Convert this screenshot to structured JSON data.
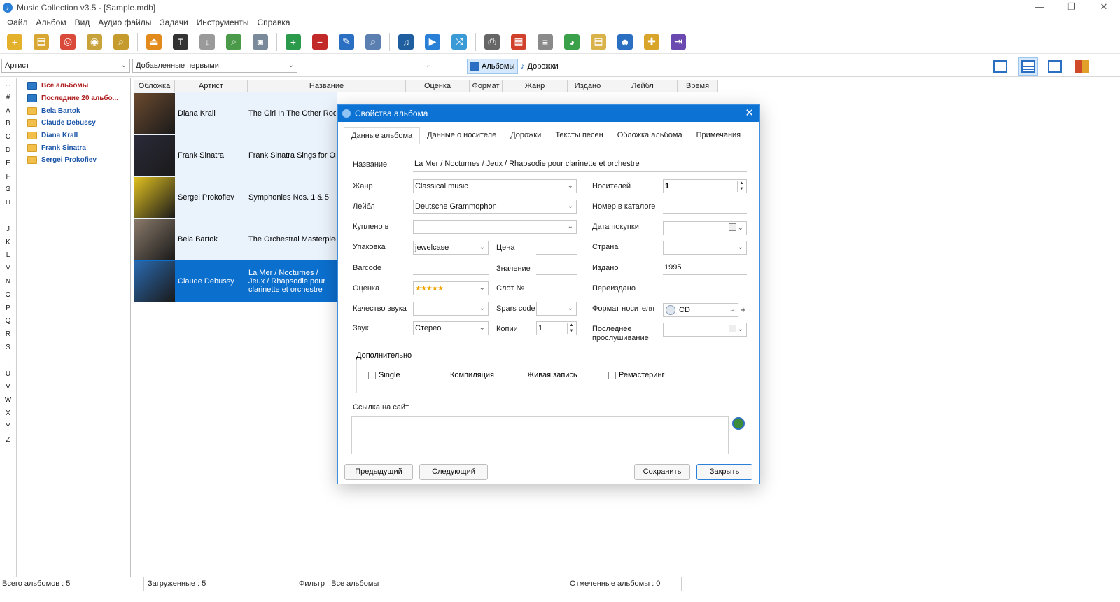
{
  "window": {
    "title": "Music Collection v3.5 - [Sample.mdb]",
    "controls": [
      "—",
      "❐",
      "✕"
    ]
  },
  "menu": [
    "Файл",
    "Альбом",
    "Вид",
    "Аудио файлы",
    "Задачи",
    "Инструменты",
    "Справка"
  ],
  "toolbar": {
    "buttons": [
      {
        "name": "add-album-icon",
        "color": "#e3b12b",
        "glyph": "+"
      },
      {
        "name": "add-folder-icon",
        "color": "#d8a632",
        "glyph": "▤"
      },
      {
        "name": "lifebuoy-icon",
        "color": "#d94a3a",
        "glyph": "◎"
      },
      {
        "name": "disc-add-icon",
        "color": "#c8a23a",
        "glyph": "◉"
      },
      {
        "name": "search-file-icon",
        "color": "#c59b2e",
        "glyph": "⌕"
      },
      {
        "name": "eject-icon",
        "color": "#e38a1c",
        "glyph": "⏏"
      },
      {
        "name": "text-disc-icon",
        "color": "#333333",
        "glyph": "T"
      },
      {
        "name": "download-icon",
        "color": "#9a9a9a",
        "glyph": "↓"
      },
      {
        "name": "find-icon",
        "color": "#4a9a4a",
        "glyph": "⌕"
      },
      {
        "name": "camera-icon",
        "color": "#7a8a9a",
        "glyph": "◙"
      },
      {
        "name": "new-record-icon",
        "color": "#2b9a4a",
        "glyph": "+"
      },
      {
        "name": "delete-icon",
        "color": "#c22a2a",
        "glyph": "−"
      },
      {
        "name": "edit-icon",
        "color": "#2a6fc2",
        "glyph": "✎"
      },
      {
        "name": "search-list-icon",
        "color": "#5a7fb0",
        "glyph": "⌕"
      },
      {
        "name": "search-music-icon",
        "color": "#1f5f9f",
        "glyph": "♫"
      },
      {
        "name": "play-icon",
        "color": "#2a7fd6",
        "glyph": "▶"
      },
      {
        "name": "shuffle-icon",
        "color": "#3a9ad6",
        "glyph": "⤨"
      },
      {
        "name": "print-icon",
        "color": "#666666",
        "glyph": "⎙"
      },
      {
        "name": "calendar-icon",
        "color": "#d0402a",
        "glyph": "▦"
      },
      {
        "name": "report-icon",
        "color": "#8a8a8a",
        "glyph": "≡"
      },
      {
        "name": "pie-chart-icon",
        "color": "#3aa04a",
        "glyph": "◕"
      },
      {
        "name": "notes-icon",
        "color": "#d9b24a",
        "glyph": "▤"
      },
      {
        "name": "user-icon",
        "color": "#2a6fc2",
        "glyph": "☻"
      },
      {
        "name": "plugin-icon",
        "color": "#d9a42a",
        "glyph": "✚"
      },
      {
        "name": "exit-icon",
        "color": "#6a4ab0",
        "glyph": "⇥"
      }
    ]
  },
  "filter": {
    "group_by": "Артист",
    "sort_by": "Добавленные первыми",
    "search_value": "",
    "albums_toggle": "Альбомы",
    "tracks_toggle": "Дорожки"
  },
  "alphabet": [
    "...",
    "#",
    "A",
    "B",
    "C",
    "D",
    "E",
    "F",
    "G",
    "H",
    "I",
    "J",
    "K",
    "L",
    "M",
    "N",
    "O",
    "P",
    "Q",
    "R",
    "S",
    "T",
    "U",
    "V",
    "W",
    "X",
    "Y",
    "Z"
  ],
  "tree": [
    {
      "label": "Все альбомы",
      "type": "special",
      "folder": "blue"
    },
    {
      "label": "Последние 20 альбо...",
      "type": "special",
      "folder": "blue"
    },
    {
      "label": "Bela Bartok",
      "type": "artist",
      "folder": "yellow"
    },
    {
      "label": "Claude Debussy",
      "type": "artist",
      "folder": "yellow"
    },
    {
      "label": "Diana Krall",
      "type": "artist",
      "folder": "yellow"
    },
    {
      "label": "Frank Sinatra",
      "type": "artist",
      "folder": "yellow"
    },
    {
      "label": "Sergei Prokofiev",
      "type": "artist",
      "folder": "yellow"
    }
  ],
  "grid": {
    "columns": [
      "Обложка",
      "Артист",
      "Название",
      "Оценка",
      "Формат",
      "Жанр",
      "Издано",
      "Лейбл",
      "Время"
    ],
    "rows": [
      {
        "artist": "Diana Krall",
        "title": "The Girl In The Other Room",
        "cover": "#6b4a2e",
        "selected": false
      },
      {
        "artist": "Frank Sinatra",
        "title": "Frank Sinatra Sings for Only the Lonely",
        "cover": "#2a2a3a",
        "selected": false
      },
      {
        "artist": "Sergei Prokofiev",
        "title": "Symphonies Nos. 1 & 5",
        "cover": "#e0c020",
        "selected": false
      },
      {
        "artist": "Bela Bartok",
        "title": "The Orchestral Masterpieces",
        "cover": "#8a7a6a",
        "selected": false
      },
      {
        "artist": "Claude Debussy",
        "title": "La Mer / Nocturnes / Jeux / Rhapsodie pour clarinette et orchestre",
        "cover": "#2a6ab0",
        "selected": true
      }
    ]
  },
  "status": {
    "total": "Всего альбомов : 5",
    "loaded": "Загруженные : 5",
    "filter": "Фильтр : Все альбомы",
    "marked": "Отмеченные альбомы : 0"
  },
  "dialog": {
    "title": "Свойства альбома",
    "tabs": [
      "Данные альбома",
      "Данные о носителе",
      "Дорожки",
      "Тексты песен",
      "Обложка альбома",
      "Примечания"
    ],
    "active_tab": 0,
    "labels": {
      "name": "Название",
      "genre": "Жанр",
      "label": "Лейбл",
      "bought_in": "Куплено в",
      "packaging": "Упаковка",
      "barcode": "Barcode",
      "rating": "Оценка",
      "sound_quality": "Качество звука",
      "sound": "Звук",
      "price": "Цена",
      "value": "Значение",
      "slot": "Слот №",
      "spars": "Spars code",
      "copies": "Копии",
      "media_count": "Носителей",
      "catalog_no": "Номер в каталоге",
      "purchase_date": "Дата покупки",
      "country": "Страна",
      "released": "Издано",
      "reissued": "Переиздано",
      "media_format": "Формат носителя",
      "last_played_1": "Последнее",
      "last_played_2": "прослушивание"
    },
    "values": {
      "name": "La Mer / Nocturnes / Jeux / Rhapsodie pour clarinette et orchestre",
      "genre": "Classical music",
      "label": "Deutsche Grammophon",
      "bought_in": "",
      "packaging": "jewelcase",
      "barcode": "",
      "rating": "★★★★★",
      "rating_stars": 5,
      "sound_quality": "",
      "sound": "Стерео",
      "price": "",
      "value": "",
      "slot": "",
      "spars": "",
      "copies": "1",
      "media_count": "1",
      "catalog_no": "",
      "purchase_date": "",
      "country": "",
      "released": "1995",
      "reissued": "",
      "media_format": "CD",
      "last_played": ""
    },
    "extra_group": "Дополнительно",
    "checkboxes": [
      {
        "label": "Single",
        "checked": false
      },
      {
        "label": "Компиляция",
        "checked": false
      },
      {
        "label": "Живая запись",
        "checked": false
      },
      {
        "label": "Ремастеринг",
        "checked": false
      }
    ],
    "url_label": "Ссылка на сайт",
    "url_value": "",
    "buttons": {
      "prev": "Предыдущий",
      "next": "Следующий",
      "save": "Сохранить",
      "close": "Закрыть"
    }
  },
  "colors": {
    "accent": "#0c72d4",
    "selection": "#0b6fce",
    "tree_special": "#b02020",
    "tree_artist": "#1c56a8"
  }
}
